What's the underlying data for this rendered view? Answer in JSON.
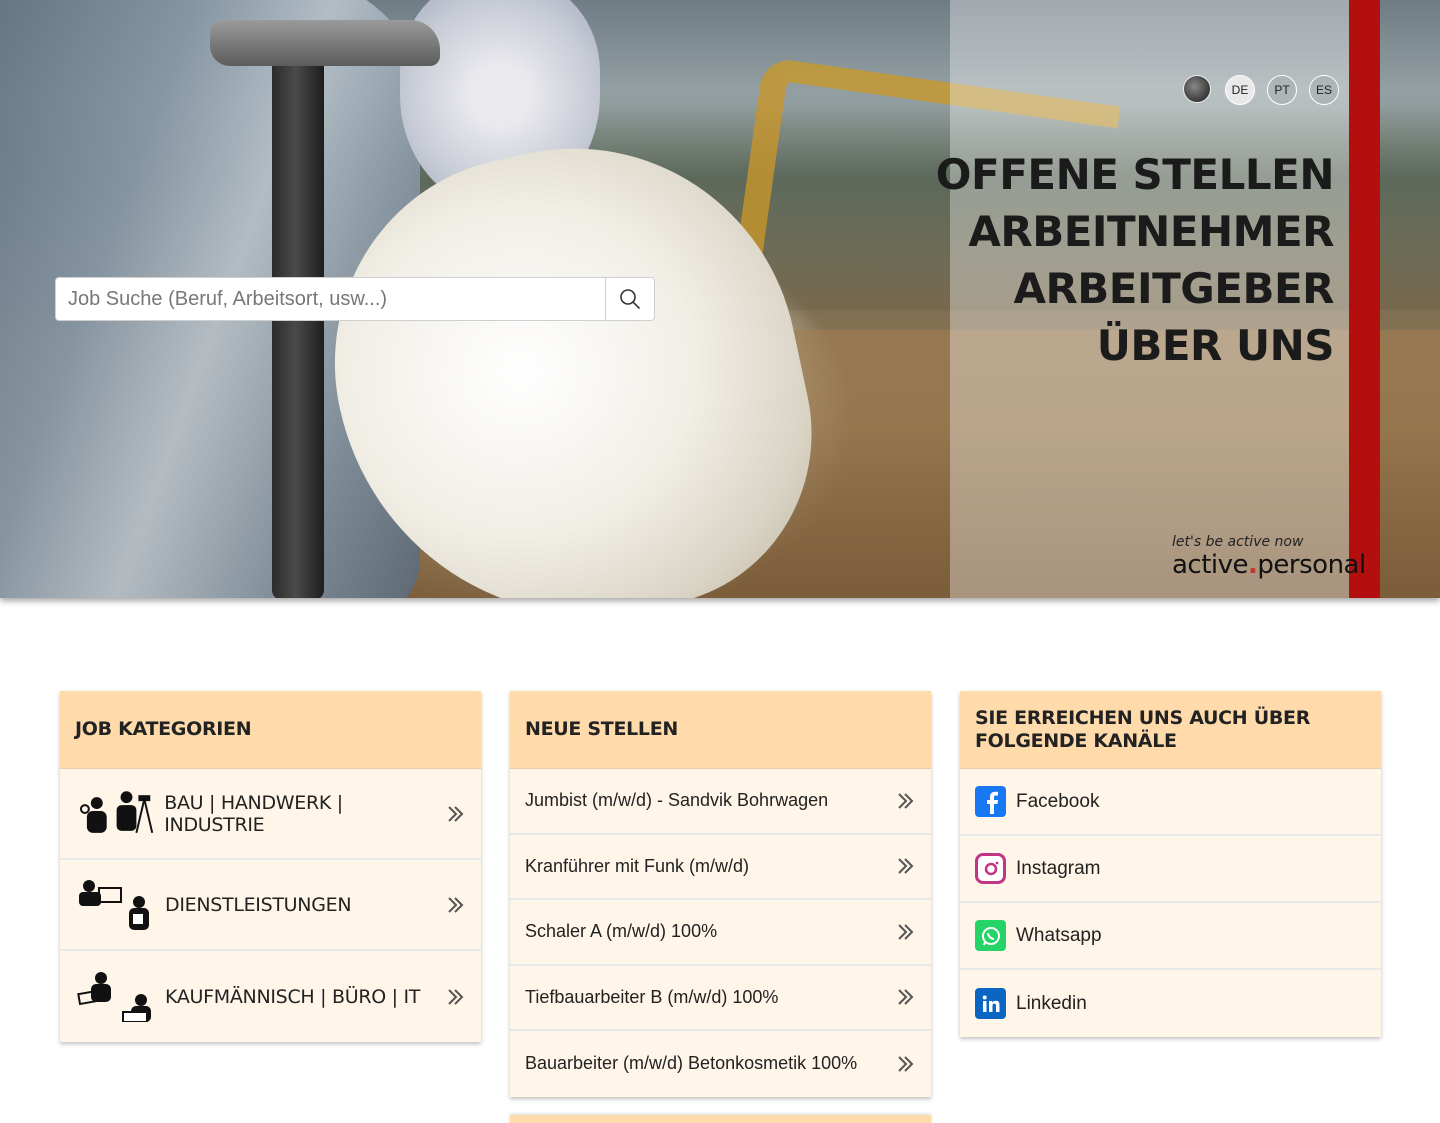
{
  "languages": [
    {
      "code": "DE",
      "active": true
    },
    {
      "code": "PT",
      "active": false
    },
    {
      "code": "ES",
      "active": false
    }
  ],
  "nav": [
    "OFFENE STELLEN",
    "ARBEITNEHMER",
    "ARBEITGEBER",
    "ÜBER UNS"
  ],
  "logo": {
    "slogan": "let's be active now",
    "brand_left": "active",
    "brand_dot": ".",
    "brand_right": "personal"
  },
  "search": {
    "placeholder": "Job Suche (Beruf, Arbeitsort, usw...)",
    "icon": "search-icon"
  },
  "categories": {
    "title": "JOB KATEGORIEN",
    "items": [
      {
        "label": "BAU | HANDWERK | INDUSTRIE",
        "icon": "construction-workers-icon"
      },
      {
        "label": "DIENSTLEISTUNGEN",
        "icon": "service-workers-icon"
      },
      {
        "label": "KAUFMÄNNISCH | BÜRO | IT",
        "icon": "office-workers-icon"
      }
    ]
  },
  "jobs": {
    "title": "NEUE STELLEN",
    "items": [
      "Jumbist (m/w/d) - Sandvik Bohrwagen",
      "Kranführer mit Funk (m/w/d)",
      "Schaler A (m/w/d) 100%",
      "Tiefbauarbeiter B (m/w/d) 100%",
      "Bauarbeiter (m/w/d) Betonkosmetik 100%"
    ]
  },
  "channels": {
    "title": "SIE ERREICHEN UNS AUCH ÜBER FOLGENDE KANÄLE",
    "items": [
      {
        "label": "Facebook",
        "icon": "facebook-icon",
        "color": "#1877f2"
      },
      {
        "label": "Instagram",
        "icon": "instagram-icon",
        "color": "#c13584"
      },
      {
        "label": "Whatsapp",
        "icon": "whatsapp-icon",
        "color": "#25d366"
      },
      {
        "label": "Linkedin",
        "icon": "linkedin-icon",
        "color": "#0a66c2"
      }
    ]
  },
  "colors": {
    "accent_red": "#b30f0f",
    "card_header": "#ffdaab",
    "card_body": "#fff5e9"
  }
}
